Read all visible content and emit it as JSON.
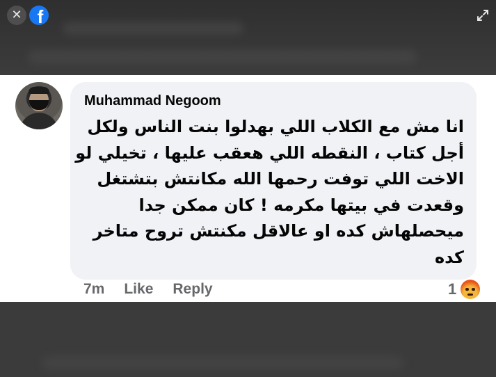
{
  "top_bar": {
    "close_icon": "close-icon",
    "logo_icon": "facebook-logo-icon",
    "logo_glyph": "f",
    "expand_icon": "expand-icon"
  },
  "comment": {
    "author": "Muhammad Negoom",
    "lines": [
      "انا مش مع الكلاب اللي بهدلوا بنت الناس ولكل",
      "أجل كتاب ، النقطه اللي هعقب عليها ، تخيلي لو",
      "الاخت اللي توفت رحمها الله مكانتش بتشتغل",
      "وقعدت في بيتها مكرمه ! كان ممكن جدا",
      "ميحصلهاش كده او عالاقل مكنتش تروح متاخر",
      "كده"
    ],
    "time": "7m",
    "like_label": "Like",
    "reply_label": "Reply",
    "reaction_count": "1",
    "reaction_icon": "angry-reaction-icon"
  },
  "colors": {
    "facebook_blue": "#1877f2",
    "bubble_bg": "#f0f2f5",
    "meta_text": "#65676b"
  }
}
